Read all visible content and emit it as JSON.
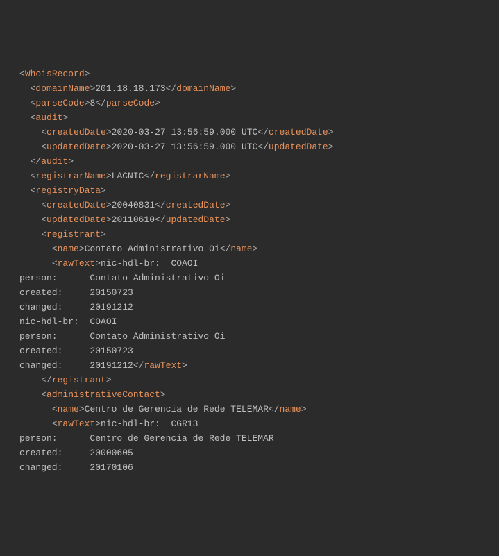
{
  "xml": {
    "root": "WhoisRecord",
    "domainName": "201.18.18.173",
    "parseCode": "8",
    "audit": {
      "createdDate": "2020-03-27 13:56:59.000 UTC",
      "updatedDate": "2020-03-27 13:56:59.000 UTC"
    },
    "registrarName": "LACNIC",
    "registryData": {
      "createdDate": "20040831",
      "updatedDate": "20110610",
      "registrant": {
        "name": "Contato Administrativo Oi",
        "rawText": "nic-hdl-br:  COAOI\nperson:      Contato Administrativo Oi\ncreated:     20150723\nchanged:     20191212\nnic-hdl-br:  COAOI\nperson:      Contato Administrativo Oi\ncreated:     20150723\nchanged:     20191212"
      },
      "administrativeContact": {
        "name": "Centro de Gerencia de Rede TELEMAR",
        "rawText": "nic-hdl-br:  CGR13\nperson:      Centro de Gerencia de Rede TELEMAR\ncreated:     20000605\nchanged:     20170106"
      }
    }
  },
  "tags": {
    "WhoisRecord": "WhoisRecord",
    "domainName": "domainName",
    "parseCode": "parseCode",
    "audit": "audit",
    "createdDate": "createdDate",
    "updatedDate": "updatedDate",
    "registrarName": "registrarName",
    "registryData": "registryData",
    "registrant": "registrant",
    "name": "name",
    "rawText": "rawText",
    "administrativeContact": "administrativeContact"
  },
  "rawLines": {
    "r1": "person:      Contato Administrativo Oi",
    "r2": "created:     20150723",
    "r3": "changed:     20191212",
    "r4": "nic-hdl-br:  COAOI",
    "r5": "person:      Contato Administrativo Oi",
    "r6": "created:     20150723",
    "r7": "changed:     20191212",
    "r8": "person:      Centro de Gerencia de Rede TELEMAR",
    "r9": "created:     20000605",
    "r10": "changed:     20170106",
    "rawStart1": "nic-hdl-br:  COAOI",
    "rawStart2": "nic-hdl-br:  CGR13"
  }
}
